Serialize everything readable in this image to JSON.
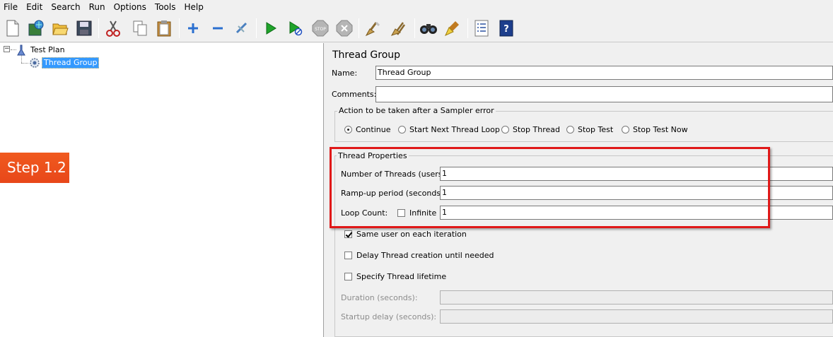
{
  "menu": [
    "File",
    "Edit",
    "Search",
    "Run",
    "Options",
    "Tools",
    "Help"
  ],
  "toolbar": {
    "buttons": [
      {
        "name": "new-icon"
      },
      {
        "name": "templates-icon"
      },
      {
        "name": "open-icon"
      },
      {
        "name": "save-icon"
      },
      {
        "name": "cut-icon"
      },
      {
        "name": "copy-icon"
      },
      {
        "name": "paste-icon"
      },
      {
        "name": "expand-icon"
      },
      {
        "name": "collapse-icon"
      },
      {
        "name": "toggle-icon"
      },
      {
        "name": "start-icon"
      },
      {
        "name": "start-no-pauses-icon"
      },
      {
        "name": "stop-icon"
      },
      {
        "name": "shutdown-icon"
      },
      {
        "name": "clear-icon"
      },
      {
        "name": "clear-all-icon"
      },
      {
        "name": "search-icon"
      },
      {
        "name": "reset-search-icon"
      },
      {
        "name": "function-helper-icon"
      },
      {
        "name": "help-icon"
      }
    ]
  },
  "tree": {
    "root_label": "Test Plan",
    "child_label": "Thread Group",
    "expander_symbol": "−"
  },
  "badge": {
    "text": "Step 1.2",
    "color": "#ee5420"
  },
  "panel": {
    "title": "Thread Group",
    "name_label": "Name:",
    "name_value": "Thread Group",
    "comments_label": "Comments:",
    "comments_value": "",
    "error_group_title": "Action to be taken after a Sampler error",
    "error_options": [
      "Continue",
      "Start Next Thread Loop",
      "Stop Thread",
      "Stop Test",
      "Stop Test Now"
    ],
    "error_selected": "Continue",
    "thread_props_title": "Thread Properties",
    "threads_label": "Number of Threads (users):",
    "threads_value": "1",
    "rampup_label": "Ramp-up period (seconds):",
    "rampup_value": "1",
    "loop_label": "Loop Count:",
    "infinite_label": "Infinite",
    "infinite_checked": false,
    "loop_value": "1",
    "same_user_label": "Same user on each iteration",
    "same_user_checked": true,
    "delay_label": "Delay Thread creation until needed",
    "delay_checked": false,
    "lifetime_label": "Specify Thread lifetime",
    "lifetime_checked": false,
    "duration_label": "Duration (seconds):",
    "duration_value": "",
    "startup_label": "Startup delay (seconds):",
    "startup_value": ""
  },
  "colors": {
    "highlight": "#e01818",
    "selection": "#3399ff"
  }
}
